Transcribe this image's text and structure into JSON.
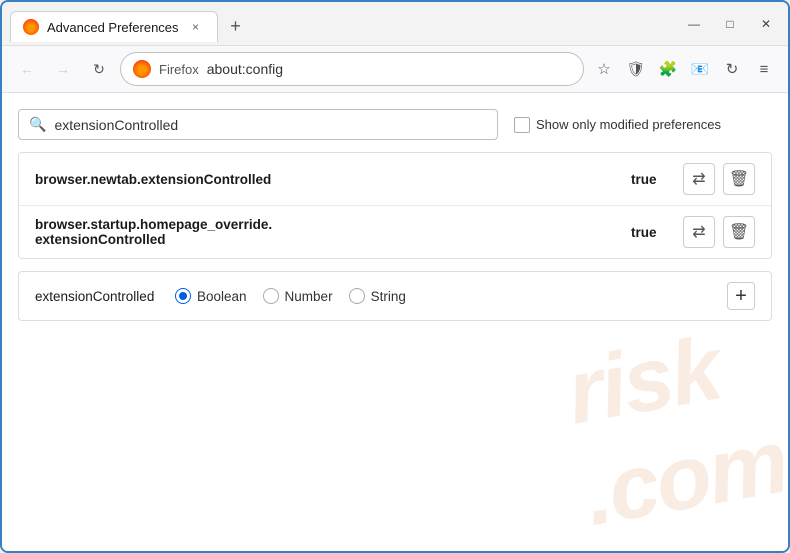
{
  "browser": {
    "tab_title": "Advanced Preferences",
    "tab_close": "×",
    "new_tab": "+",
    "win_minimize": "—",
    "win_maximize": "□",
    "win_close": "✕"
  },
  "navbar": {
    "back": "←",
    "forward": "→",
    "reload": "↻",
    "browser_name": "Firefox",
    "address": "about:config",
    "bookmark_icon": "☆",
    "shield_icon": "🛡",
    "extension_icon": "🧩",
    "mail_icon": "📧",
    "account_icon": "↻",
    "menu_icon": "≡"
  },
  "page": {
    "search_placeholder": "extensionControlled",
    "show_modified_label": "Show only modified preferences",
    "watermark_line1": "risk",
    "watermark_line2": ".com"
  },
  "preferences": [
    {
      "name": "browser.newtab.extensionControlled",
      "value": "true",
      "action_toggle": "⇄",
      "action_delete": "🗑"
    },
    {
      "name": "browser.startup.homepage_override.\nextensionControlled",
      "name_line1": "browser.startup.homepage_override.",
      "name_line2": "extensionControlled",
      "value": "true",
      "action_toggle": "⇄",
      "action_delete": "🗑"
    }
  ],
  "add_preference": {
    "name": "extensionControlled",
    "types": [
      {
        "label": "Boolean",
        "checked": true
      },
      {
        "label": "Number",
        "checked": false
      },
      {
        "label": "String",
        "checked": false
      }
    ],
    "add_btn": "+"
  }
}
